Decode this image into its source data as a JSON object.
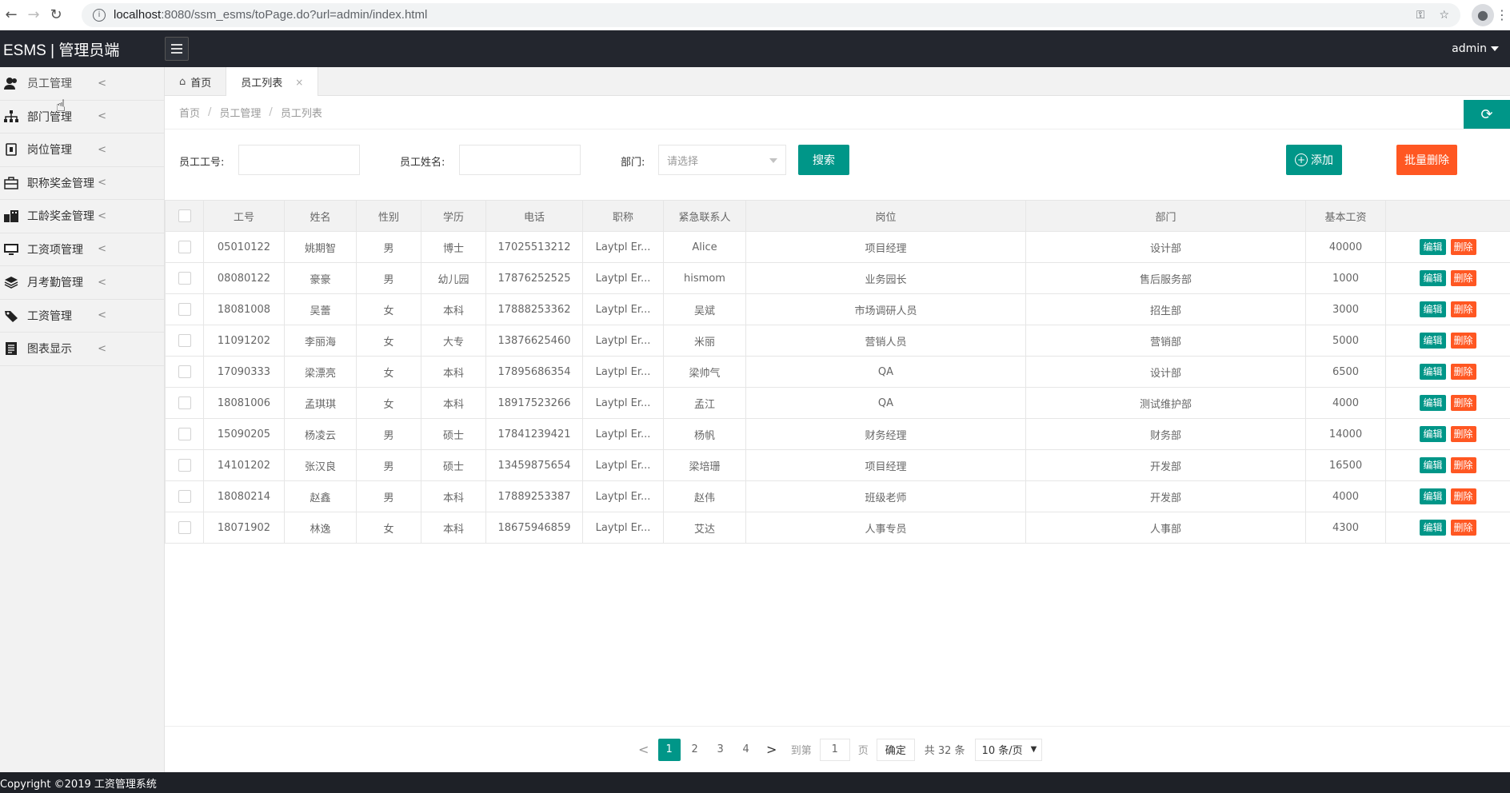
{
  "browser": {
    "url_host": "localhost",
    "url_rest": ":8080/ssm_esms/toPage.do?url=admin/index.html"
  },
  "header": {
    "logo": "ESMS | 管理员端",
    "user": "admin"
  },
  "sidebar": {
    "items": [
      {
        "label": "员工管理",
        "icon": "users-icon"
      },
      {
        "label": "部门管理",
        "icon": "org-chart-icon"
      },
      {
        "label": "岗位管理",
        "icon": "badge-icon"
      },
      {
        "label": "职称奖金管理",
        "icon": "briefcase-icon"
      },
      {
        "label": "工龄奖金管理",
        "icon": "building-icon"
      },
      {
        "label": "工资项管理",
        "icon": "monitor-icon"
      },
      {
        "label": "月考勤管理",
        "icon": "layers-icon"
      },
      {
        "label": "工资管理",
        "icon": "tag-icon"
      },
      {
        "label": "图表显示",
        "icon": "document-icon"
      }
    ]
  },
  "tabs": {
    "home": "首页",
    "current": "员工列表",
    "close": "×"
  },
  "breadcrumb": [
    "首页",
    "员工管理",
    "员工列表"
  ],
  "search": {
    "id_label": "员工工号:",
    "name_label": "员工姓名:",
    "dept_label": "部门:",
    "dept_placeholder": "请选择",
    "search_btn": "搜索",
    "add_btn": "添加",
    "batch_delete_btn": "批量删除"
  },
  "table": {
    "headers": [
      "工号",
      "姓名",
      "性别",
      "学历",
      "电话",
      "职称",
      "紧急联系人",
      "岗位",
      "部门",
      "基本工资"
    ],
    "edit_label": "编辑",
    "delete_label": "删除",
    "rows": [
      [
        "05010122",
        "姚期智",
        "男",
        "博士",
        "17025513212",
        "Laytpl Er...",
        "Alice",
        "项目经理",
        "设计部",
        "40000"
      ],
      [
        "08080122",
        "豪豪",
        "男",
        "幼儿园",
        "17876252525",
        "Laytpl Er...",
        "hismom",
        "业务园长",
        "售后服务部",
        "1000"
      ],
      [
        "18081008",
        "吴蕾",
        "女",
        "本科",
        "17888253362",
        "Laytpl Er...",
        "吴斌",
        "市场调研人员",
        "招生部",
        "3000"
      ],
      [
        "11091202",
        "李丽海",
        "女",
        "大专",
        "13876625460",
        "Laytpl Er...",
        "米丽",
        "营销人员",
        "营销部",
        "5000"
      ],
      [
        "17090333",
        "梁漂亮",
        "女",
        "本科",
        "17895686354",
        "Laytpl Er...",
        "梁帅气",
        "QA",
        "设计部",
        "6500"
      ],
      [
        "18081006",
        "孟琪琪",
        "女",
        "本科",
        "18917523266",
        "Laytpl Er...",
        "孟江",
        "QA",
        "测试维护部",
        "4000"
      ],
      [
        "15090205",
        "杨凌云",
        "男",
        "硕士",
        "17841239421",
        "Laytpl Er...",
        "杨帆",
        "财务经理",
        "财务部",
        "14000"
      ],
      [
        "14101202",
        "张汉良",
        "男",
        "硕士",
        "13459875654",
        "Laytpl Er...",
        "梁培珊",
        "项目经理",
        "开发部",
        "16500"
      ],
      [
        "18080214",
        "赵鑫",
        "男",
        "本科",
        "17889253387",
        "Laytpl Er...",
        "赵伟",
        "班级老师",
        "开发部",
        "4000"
      ],
      [
        "18071902",
        "林逸",
        "女",
        "本科",
        "18675946859",
        "Laytpl Er...",
        "艾达",
        "人事专员",
        "人事部",
        "4300"
      ]
    ]
  },
  "pager": {
    "prev": "<",
    "pages": [
      "1",
      "2",
      "3",
      "4"
    ],
    "next": ">",
    "current": "1",
    "goto_label": "到第",
    "goto_value": "1",
    "page_unit": "页",
    "confirm": "确定",
    "total": "共 32 条",
    "page_size": "10 条/页"
  },
  "footer": "Copyright ©2019 工资管理系统",
  "colors": {
    "primary": "#009688",
    "danger": "#ff5722",
    "header": "#23262e"
  }
}
